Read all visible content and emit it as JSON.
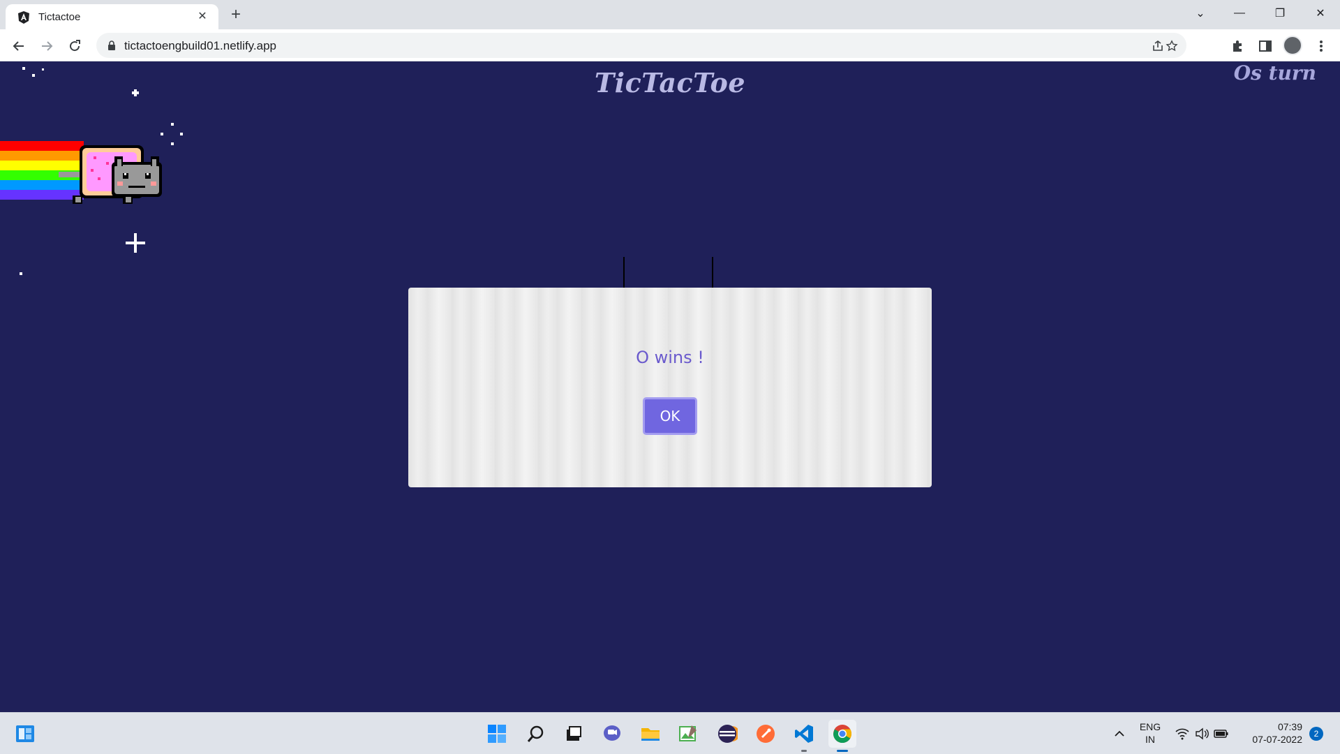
{
  "browser": {
    "tab_title": "Tictactoe",
    "tab_close": "✕",
    "new_tab": "+",
    "url": "tictactoengbuild01.netlify.app",
    "window_controls": {
      "chevron": "⌄",
      "minimize": "—",
      "restore": "❐",
      "close": "✕"
    }
  },
  "page": {
    "title": "TicTacToe",
    "turn_label": "Os turn",
    "background_color": "#1f2059"
  },
  "modal": {
    "message": "O wins !",
    "ok_label": "OK",
    "accent_color": "#7066e0"
  },
  "taskbar": {
    "lang_line1": "ENG",
    "lang_line2": "IN",
    "time": "07:39",
    "date": "07-07-2022",
    "notification_count": "2",
    "apps": [
      "widgets-icon",
      "start-icon",
      "search-icon",
      "task-view-icon",
      "teams-chat-icon",
      "file-explorer-icon",
      "image-editor-icon",
      "eclipse-icon",
      "postman-icon",
      "vscode-icon",
      "chrome-icon"
    ]
  }
}
